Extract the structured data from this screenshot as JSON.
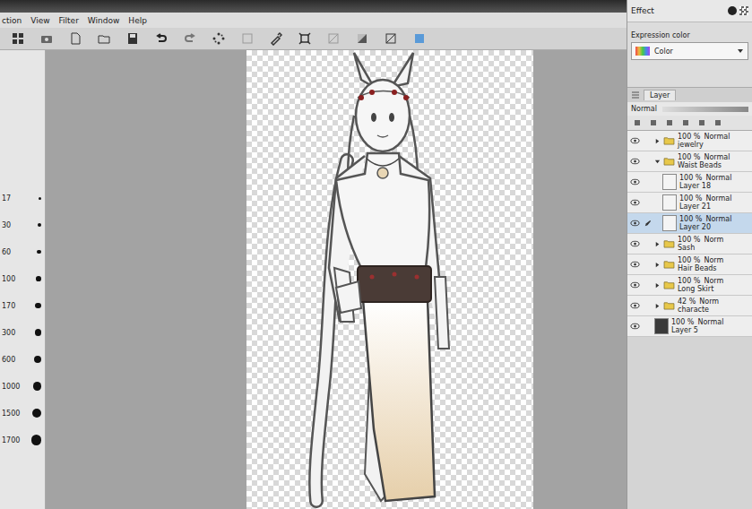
{
  "menu": [
    "ction",
    "View",
    "Filter",
    "Window",
    "Help"
  ],
  "brush_sizes": [
    "17",
    "30",
    "60",
    "100",
    "170",
    "300",
    "600",
    "1000",
    "1500",
    "1700"
  ],
  "right_panel": {
    "effect_label": "Effect",
    "expression_color": {
      "label": "Expression color",
      "value": "Color"
    }
  },
  "layer_panel": {
    "tab": "Layer",
    "blend_mode": "Normal",
    "layers": [
      {
        "opacity": "100 %",
        "blend": "Normal",
        "name": "jewelry",
        "kind": "folder",
        "expanded": false,
        "in_folder": false,
        "visible": true,
        "selected": false,
        "color": "#e8c84a"
      },
      {
        "opacity": "100 %",
        "blend": "Normal",
        "name": "Waist Beads",
        "kind": "folder",
        "expanded": true,
        "in_folder": false,
        "visible": true,
        "selected": false,
        "color": "#e8c84a"
      },
      {
        "opacity": "100 %",
        "blend": "Normal",
        "name": "Layer 18",
        "kind": "layer",
        "expanded": false,
        "in_folder": true,
        "visible": true,
        "selected": false,
        "color": "#f4f4f4"
      },
      {
        "opacity": "100 %",
        "blend": "Normal",
        "name": "Layer 21",
        "kind": "layer",
        "expanded": false,
        "in_folder": true,
        "visible": true,
        "selected": false,
        "color": "#f4f4f4"
      },
      {
        "opacity": "100 %",
        "blend": "Normal",
        "name": "Layer 20",
        "kind": "layer",
        "expanded": false,
        "in_folder": true,
        "visible": true,
        "selected": true,
        "color": "#f4f4f4"
      },
      {
        "opacity": "100 %",
        "blend": "Norm",
        "name": "Sash",
        "kind": "folder",
        "expanded": false,
        "in_folder": false,
        "visible": true,
        "selected": false,
        "color": "#e8c84a"
      },
      {
        "opacity": "100 %",
        "blend": "Norm",
        "name": "Hair Beads",
        "kind": "folder",
        "expanded": false,
        "in_folder": false,
        "visible": true,
        "selected": false,
        "color": "#e8c84a"
      },
      {
        "opacity": "100 %",
        "blend": "Norm",
        "name": "Long Skirt",
        "kind": "folder",
        "expanded": false,
        "in_folder": false,
        "visible": true,
        "selected": false,
        "color": "#e8c84a"
      },
      {
        "opacity": "42 %",
        "blend": "Norm",
        "name": "characte",
        "kind": "folder",
        "expanded": false,
        "in_folder": false,
        "visible": true,
        "selected": false,
        "color": "#e8c84a"
      },
      {
        "opacity": "100 %",
        "blend": "Normal",
        "name": "Layer 5",
        "kind": "layer",
        "expanded": false,
        "in_folder": false,
        "visible": true,
        "selected": false,
        "color": "#3a3a3a"
      }
    ]
  }
}
